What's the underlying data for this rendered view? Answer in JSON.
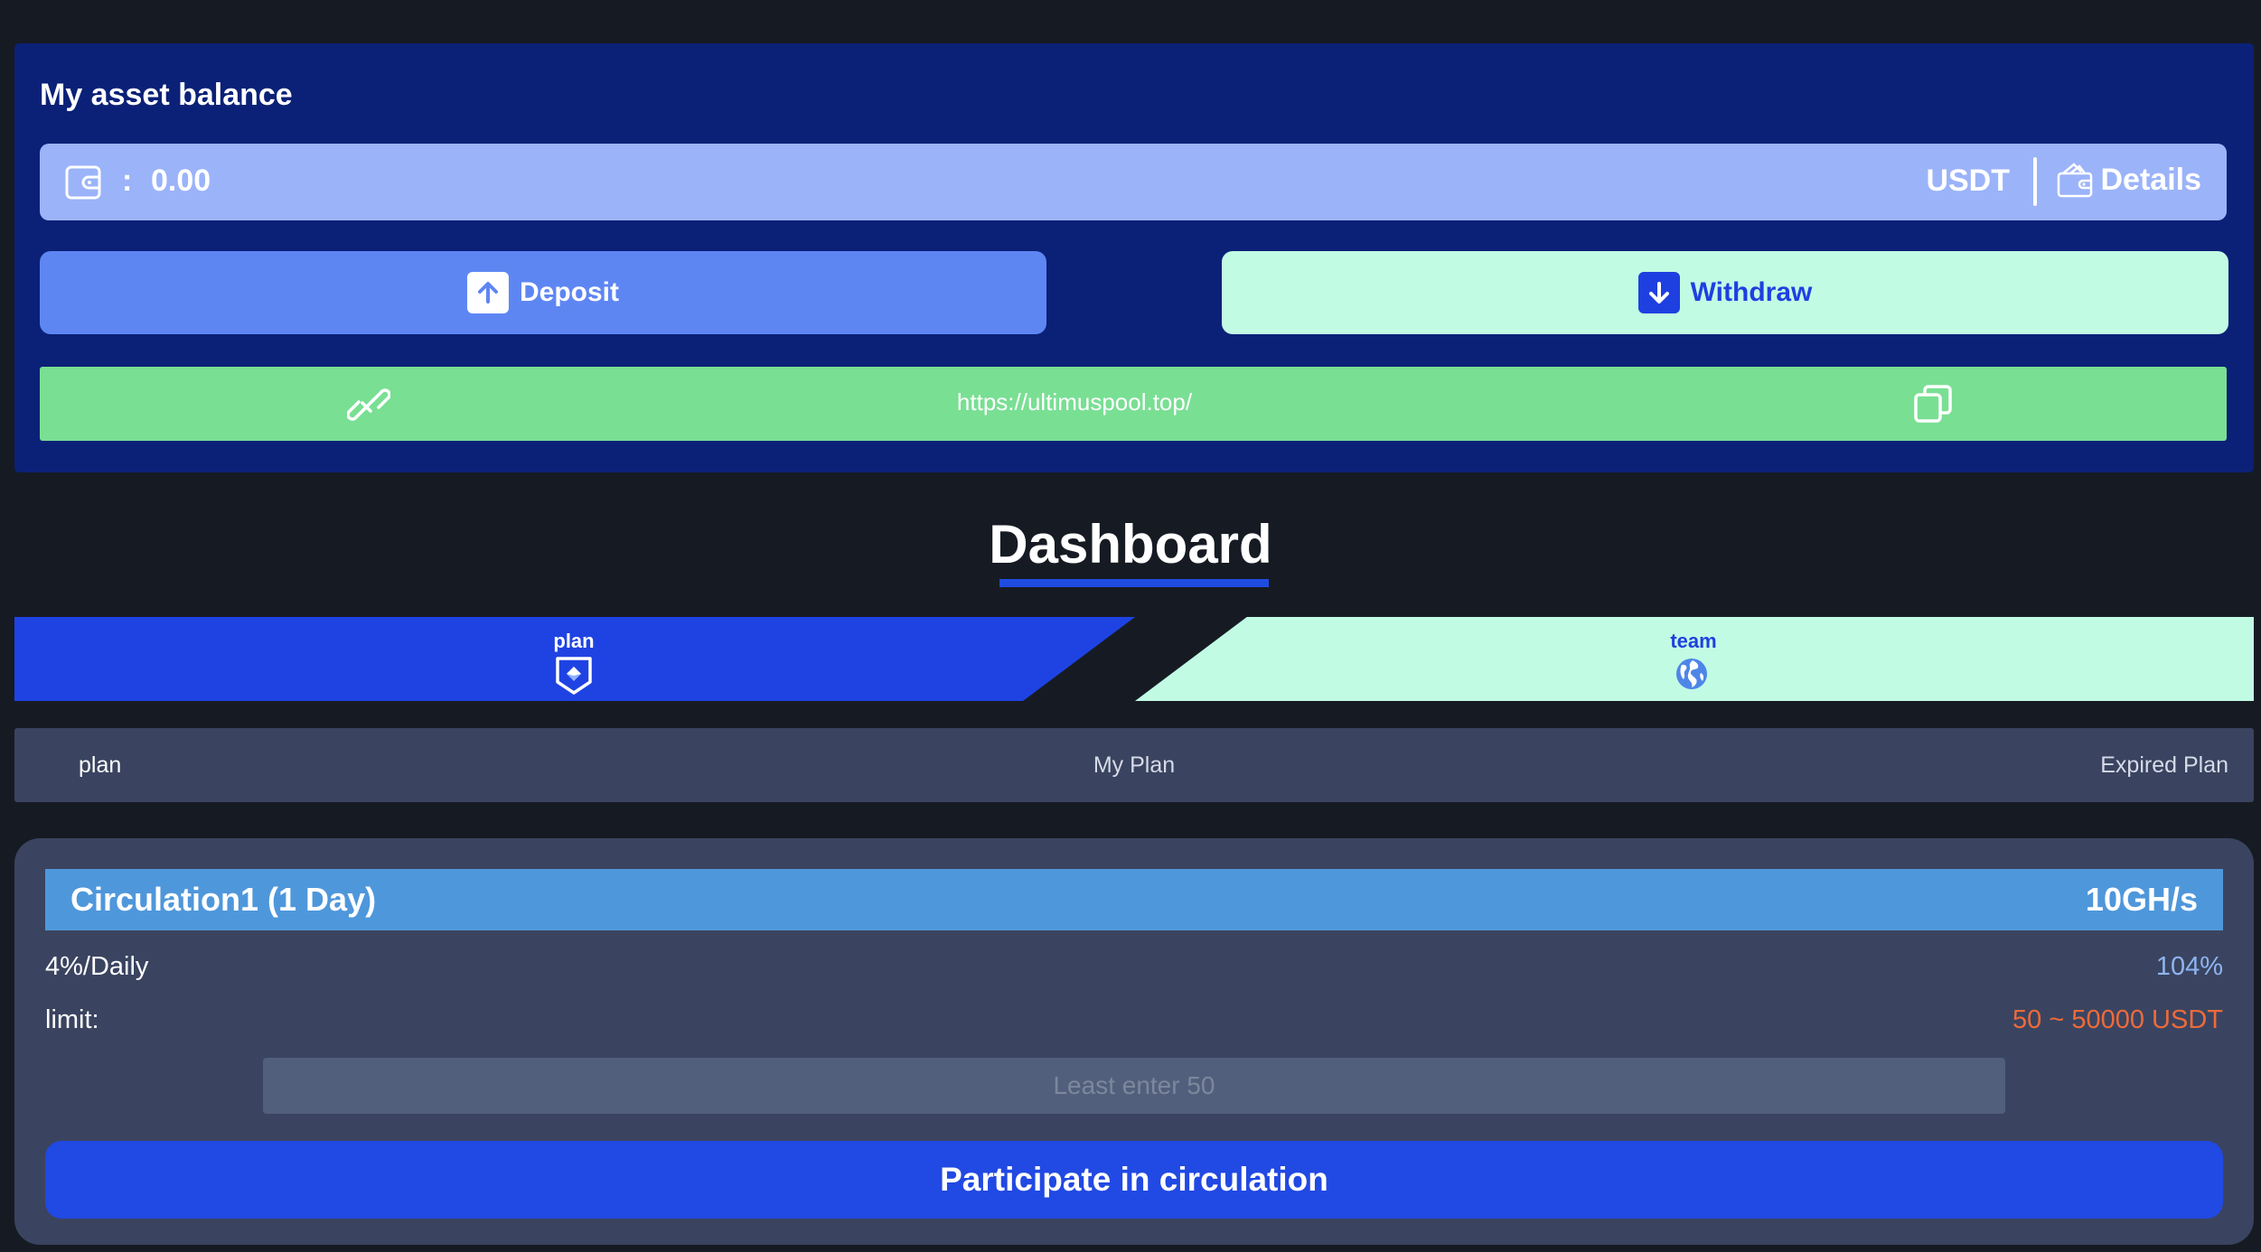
{
  "balance": {
    "title": "My asset balance",
    "colon": ":",
    "value": "0.00",
    "unit": "USDT",
    "details_label": "Details",
    "icon": "wallet-icon"
  },
  "actions": {
    "deposit_label": "Deposit",
    "withdraw_label": "Withdraw"
  },
  "invite": {
    "url": "https://ultimuspool.top/"
  },
  "dashboard": {
    "title": "Dashboard"
  },
  "tabs": [
    {
      "label": "plan",
      "icon": "shield-icon",
      "active": true
    },
    {
      "label": "team",
      "icon": "globe-icon",
      "active": false
    }
  ],
  "subnav": {
    "items": [
      "plan",
      "My Plan",
      "Expired Plan"
    ]
  },
  "plan": {
    "name": "Circulation1 (1 Day)",
    "speed": "10GH/s",
    "rate": "4%/Daily",
    "total": "104%",
    "limit_label": "limit:",
    "limit_value": "50 ~ 50000 USDT",
    "input_placeholder": "Least enter 50",
    "button_label": "Participate in circulation"
  },
  "colors": {
    "page_bg": "#161b23",
    "balance_card": "#0b2177",
    "balance_bar": "#9bb3f9",
    "deposit": "#5e86f3",
    "withdraw": "#c2fbe4",
    "link_bar": "#79df93",
    "accent": "#1f43e3",
    "plan_header": "#4f97db",
    "limit_value": "#ee6a3a",
    "total_value": "#8eb4ef"
  }
}
